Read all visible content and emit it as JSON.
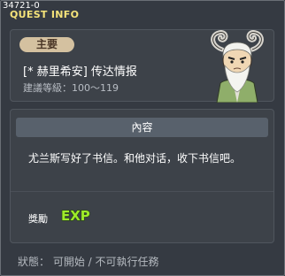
{
  "window": {
    "id": "34721-0",
    "title": "QUEST INFO"
  },
  "quest": {
    "category": "主要",
    "name": "[* 赫里希安] 传达情报",
    "level": "建議等級：100～119",
    "npc_icon": "horned-elder-npc-portrait"
  },
  "content": {
    "header": "內容",
    "description": "尤兰斯写好了书信。和他对话，收下书信吧。"
  },
  "rewards": {
    "label": "獎勵",
    "icon": "exp-icon",
    "icon_text": "EXP"
  },
  "status": {
    "text": "狀態： 可開始 / 不可執行任務"
  },
  "colors": {
    "title": "#f5e37a",
    "exp": "#9eeb2a",
    "tag": "#d4c1a0"
  }
}
